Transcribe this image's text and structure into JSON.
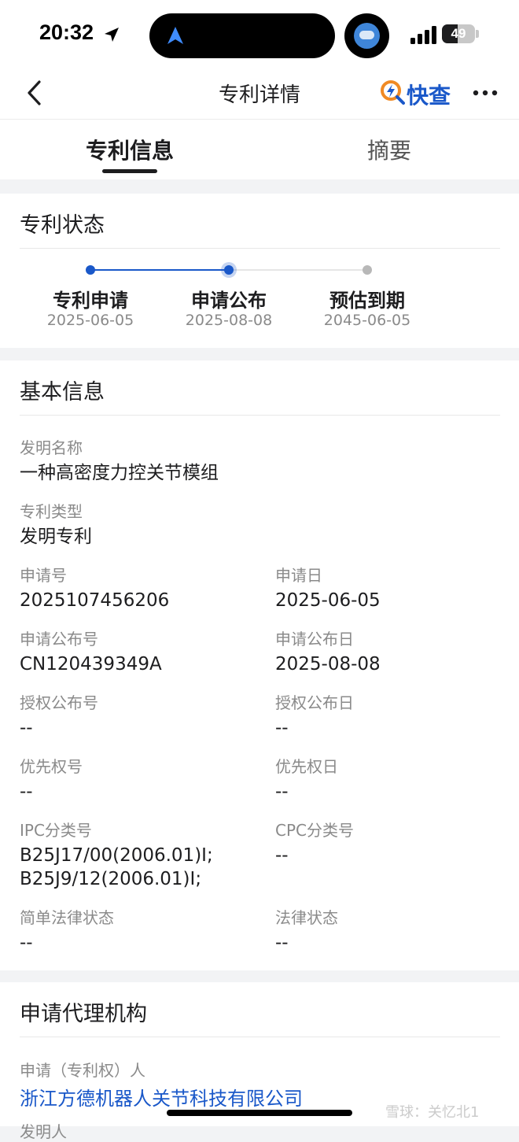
{
  "status_bar": {
    "time": "20:32",
    "battery": "49",
    "icons": [
      "location-arrow-icon",
      "navigation-arrow-icon",
      "avatar-icon",
      "signal-icon",
      "battery-icon"
    ]
  },
  "nav": {
    "title": "专利详情",
    "brand": "快查",
    "icons": [
      "back-chevron-icon",
      "lightning-search-icon",
      "more-dots-icon"
    ]
  },
  "tabs": [
    {
      "label": "专利信息",
      "active": true
    },
    {
      "label": "摘要",
      "active": false
    }
  ],
  "patent_status": {
    "title": "专利状态",
    "steps": [
      {
        "label": "专利申请",
        "date": "2025-06-05",
        "state": "done"
      },
      {
        "label": "申请公布",
        "date": "2025-08-08",
        "state": "current"
      },
      {
        "label": "预估到期",
        "date": "2045-06-05",
        "state": "pending"
      }
    ]
  },
  "basic_info": {
    "title": "基本信息",
    "invention_name_label": "发明名称",
    "invention_name": "一种高密度力控关节模组",
    "patent_type_label": "专利类型",
    "patent_type": "发明专利",
    "application_no_label": "申请号",
    "application_no": "2025107456206",
    "application_date_label": "申请日",
    "application_date": "2025-06-05",
    "publication_no_label": "申请公布号",
    "publication_no": "CN120439349A",
    "publication_date_label": "申请公布日",
    "publication_date": "2025-08-08",
    "grant_no_label": "授权公布号",
    "grant_no": "--",
    "grant_date_label": "授权公布日",
    "grant_date": "--",
    "priority_no_label": "优先权号",
    "priority_no": "--",
    "priority_date_label": "优先权日",
    "priority_date": "--",
    "ipc_label": "IPC分类号",
    "ipc_line1": "B25J17/00(2006.01)I;",
    "ipc_line2": "B25J9/12(2006.01)I;",
    "cpc_label": "CPC分类号",
    "cpc": "--",
    "simple_legal_status_label": "简单法律状态",
    "simple_legal_status": "--",
    "legal_status_label": "法律状态",
    "legal_status": "--"
  },
  "agency": {
    "title": "申请代理机构",
    "applicant_label": "申请（专利权）人",
    "applicant": "浙江方德机器人关节科技有限公司",
    "inventor_label": "发明人"
  },
  "watermark": "雪球：关忆北1",
  "colors": {
    "accent": "#1a58c9",
    "brand_orange": "#f08a24",
    "muted_text": "#8a8a8a",
    "page_bg": "#f2f3f5"
  }
}
